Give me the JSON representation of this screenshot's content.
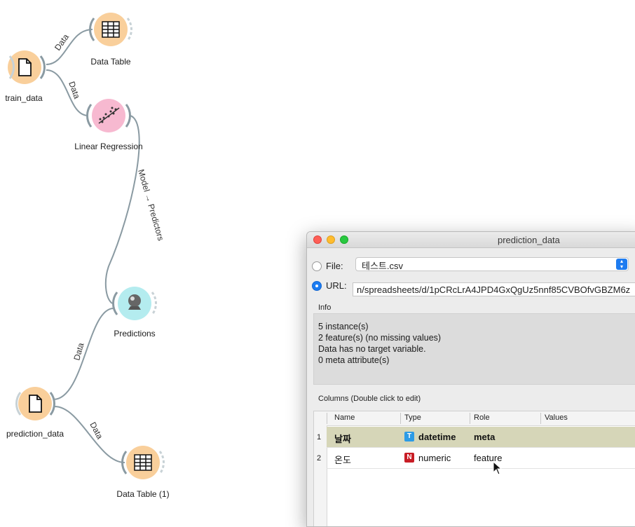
{
  "workflow": {
    "nodes": {
      "train_data": "train_data",
      "data_table": "Data Table",
      "linear_regression": "Linear Regression",
      "predictions": "Predictions",
      "prediction_data": "prediction_data",
      "data_table_1": "Data Table (1)"
    },
    "links": {
      "train_to_table": "Data",
      "train_to_lr": "Data",
      "lr_to_pred": "Model → Predictors",
      "pred_data_to_pred": "Data",
      "pred_data_to_table": "Data"
    },
    "colors": {
      "orange_node": "#f9cf9b",
      "pink_node": "#f7b9d0",
      "cyan_node": "#b4ecef",
      "link": "#8a9aa2"
    }
  },
  "window": {
    "title": "prediction_data",
    "file_label": "File:",
    "file_value": "테스트.csv",
    "url_label": "URL:",
    "url_value": "n/spreadsheets/d/1pCRcLrA4JPD4GxQgUz5nnf85CVBOfvGBZM6z",
    "info_title": "Info",
    "info_lines": [
      "5 instance(s)",
      "2 feature(s) (no missing values)",
      "Data has no target variable.",
      "0 meta attribute(s)"
    ],
    "columns_title": "Columns (Double click to edit)",
    "headers": [
      "Name",
      "Type",
      "Role",
      "Values"
    ],
    "rows": [
      {
        "num": "1",
        "name": "날짜",
        "type_icon": "T",
        "type": "datetime",
        "role": "meta",
        "values": ""
      },
      {
        "num": "2",
        "name": "온도",
        "type_icon": "N",
        "type": "numeric",
        "role": "feature",
        "values": ""
      }
    ]
  }
}
